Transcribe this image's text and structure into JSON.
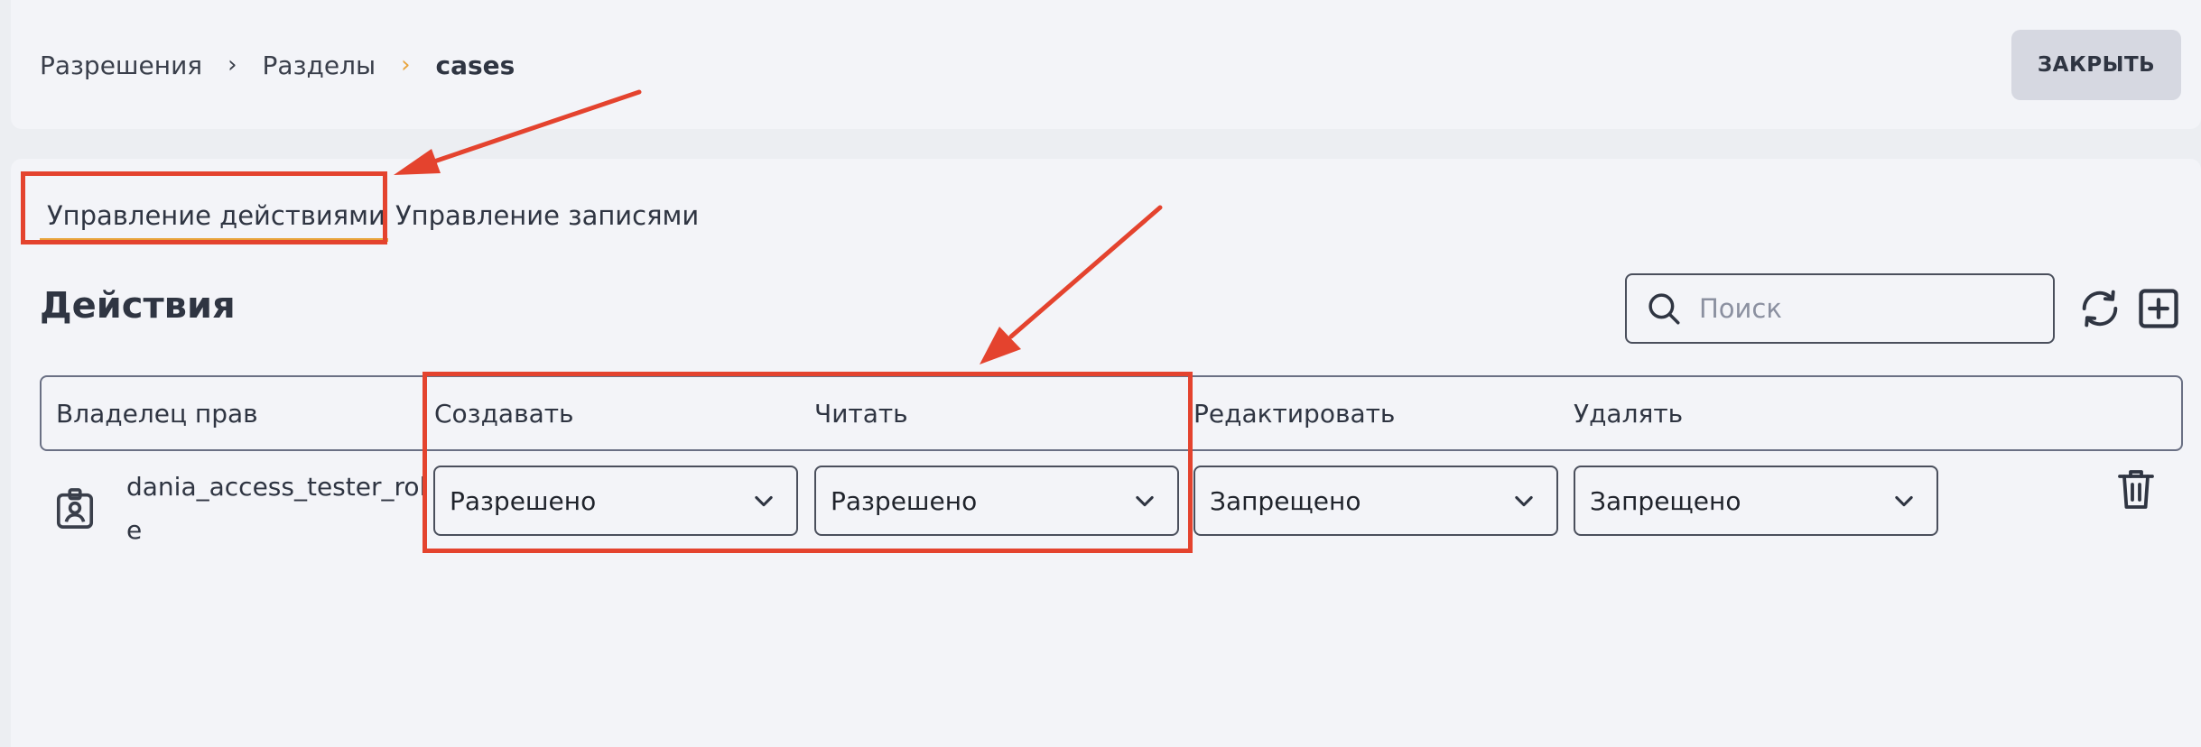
{
  "breadcrumb": {
    "item1": "Разрешения",
    "item2": "Разделы",
    "current": "cases",
    "separator": "›"
  },
  "header": {
    "close_label": "ЗАКРЫТЬ"
  },
  "tabs": [
    {
      "label": "Управление действиями",
      "active": true
    },
    {
      "label": "Управление записями",
      "active": false
    }
  ],
  "section": {
    "title": "Действия"
  },
  "search": {
    "placeholder": "Поиск",
    "value": ""
  },
  "table": {
    "columns": [
      "Владелец прав",
      "Создавать",
      "Читать",
      "Редактировать",
      "Удалять"
    ],
    "rows": [
      {
        "owner": "dania_access_tester_role",
        "create": "Разрешено",
        "read": "Разрешено",
        "edit": "Запрещено",
        "delete": "Запрещено"
      }
    ]
  },
  "icons": {
    "search": "search-icon",
    "refresh": "refresh-icon",
    "add": "add-square-icon",
    "row": "user-badge-icon",
    "select": "chevron-down-icon",
    "delete": "trash-icon"
  },
  "colors": {
    "accent": "#e8a33a",
    "annotation": "#e4432e",
    "background": "#eceef2",
    "panel": "#f3f4f8"
  }
}
